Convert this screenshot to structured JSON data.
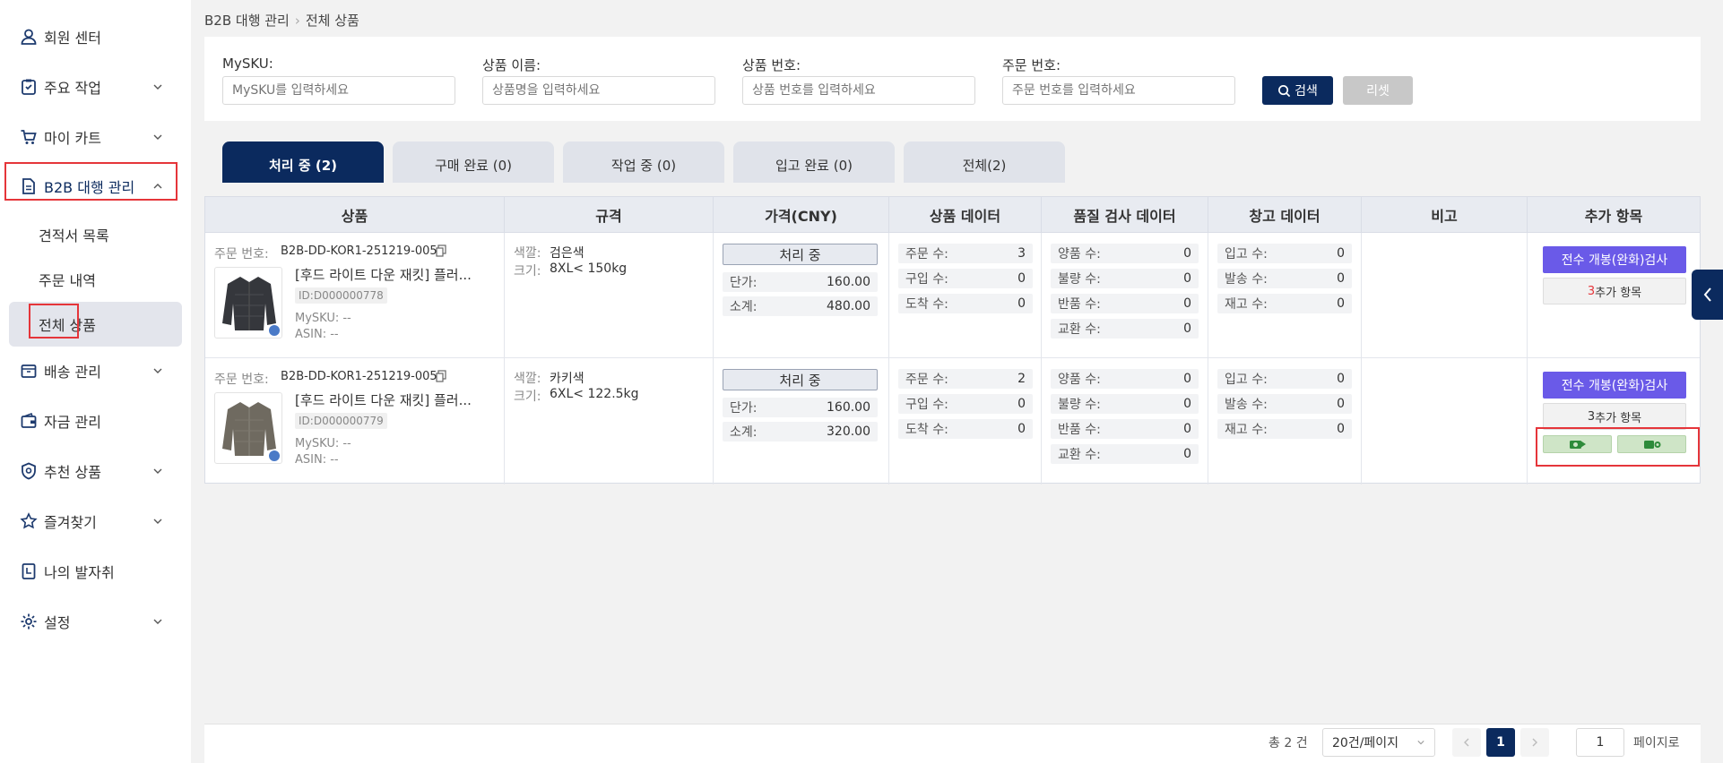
{
  "sidebar": {
    "items": [
      {
        "label": "회원 센터",
        "icon": "user-icon"
      },
      {
        "label": "주요 작업",
        "icon": "clipboard-icon"
      },
      {
        "label": "마이 카트",
        "icon": "cart-icon"
      },
      {
        "label": "B2B 대행 관리",
        "icon": "document-icon"
      },
      {
        "label": "배송 관리",
        "icon": "box-icon"
      },
      {
        "label": "자금 관리",
        "icon": "wallet-icon"
      },
      {
        "label": "추천 상품",
        "icon": "badge-icon"
      },
      {
        "label": "즐겨찾기",
        "icon": "star-icon"
      },
      {
        "label": "나의 발자취",
        "icon": "footprint-icon"
      },
      {
        "label": "설정",
        "icon": "gear-icon"
      }
    ],
    "sub_items": [
      "견적서 목록",
      "주문 내역",
      "전체 상품"
    ]
  },
  "breadcrumb": {
    "parent": "B2B 대행 관리",
    "current": "전체 상품"
  },
  "filters": {
    "mysku": {
      "label": "MySKU:",
      "placeholder": "MySKU를 입력하세요"
    },
    "name": {
      "label": "상품 이름:",
      "placeholder": "상품명을 입력하세요"
    },
    "product_no": {
      "label": "상품 번호:",
      "placeholder": "상품 번호를 입력하세요"
    },
    "order_no": {
      "label": "주문 번호:",
      "placeholder": "주문 번호를 입력하세요"
    },
    "search_label": "검색",
    "reset_label": "리셋"
  },
  "tabs": [
    "처리 중 (2)",
    "구매 완료 (0)",
    "작업 중 (0)",
    "입고 완료 (0)",
    "전체(2)"
  ],
  "columns": [
    "상품",
    "규격",
    "가격(CNY)",
    "상품 데이터",
    "품질 검사 데이터",
    "창고 데이터",
    "비고",
    "추가 항목"
  ],
  "labels": {
    "order_no": "주문 번호:",
    "color": "색깔:",
    "size": "크기:",
    "unit_price": "단가:",
    "subtotal": "소계:",
    "ordered": "주문 수:",
    "purchased": "구입 수:",
    "arrived": "도착 수:",
    "good": "양품 수:",
    "defect": "불량 수:",
    "returned": "반품 수:",
    "exchanged": "교환 수:",
    "inbound": "입고 수:",
    "shipped": "발송 수:",
    "stock": "재고 수:",
    "full_inspection": "전수 개봉(완화)검사",
    "extra_suffix": "추가 항목"
  },
  "rows": [
    {
      "order_no": "B2B-DD-KOR1-251219-005",
      "title": "[후드 라이트 다운 재킷] 플러...",
      "id": "ID:D000000778",
      "mysku": "MySKU: --",
      "asin": "ASIN: --",
      "color": "검은색",
      "size": "8XL< 150kg",
      "status": "처리 중",
      "unit_price": "160.00",
      "subtotal": "480.00",
      "ordered": "3",
      "purchased": "0",
      "arrived": "0",
      "good": "0",
      "defect": "0",
      "returned": "0",
      "exchanged": "0",
      "inbound": "0",
      "shipped": "0",
      "stock": "0",
      "extra_count": "3"
    },
    {
      "order_no": "B2B-DD-KOR1-251219-005",
      "title": "[후드 라이트 다운 재킷] 플러...",
      "id": "ID:D000000779",
      "mysku": "MySKU: --",
      "asin": "ASIN: --",
      "color": "카키색",
      "size": "6XL< 122.5kg",
      "status": "처리 중",
      "unit_price": "160.00",
      "subtotal": "320.00",
      "ordered": "2",
      "purchased": "0",
      "arrived": "0",
      "good": "0",
      "defect": "0",
      "returned": "0",
      "exchanged": "0",
      "inbound": "0",
      "shipped": "0",
      "stock": "0",
      "extra_count": "3"
    }
  ],
  "footer": {
    "total": "총 2 건",
    "per_page": "20건/페이지",
    "current_page": "1",
    "goto_value": "1",
    "goto_label": "페이지로"
  },
  "colors": {
    "navy": "#0b2a5e",
    "purple": "#6a5ae8",
    "highlight": "#e5353a",
    "green_btn": "#cfe5c7"
  }
}
